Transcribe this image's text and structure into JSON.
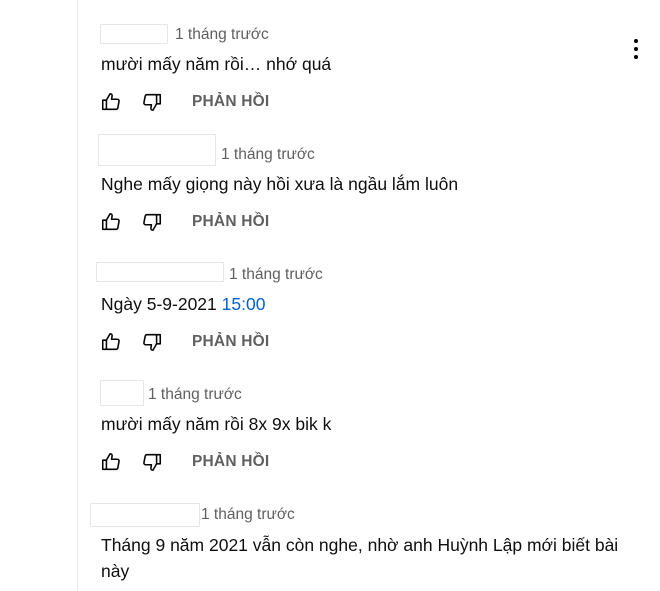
{
  "comments": [
    {
      "time": "1 tháng trước",
      "text": "mười mấy năm rồi… nhớ quá",
      "reply_label": "PHẢN HỒI"
    },
    {
      "time": "1 tháng trước",
      "text": "Nghe mấy giọng này hồi xưa là ngầu lắm luôn",
      "reply_label": "PHẢN HỒI"
    },
    {
      "time": "1 tháng trước",
      "text": "Ngày 5-9-2021 ",
      "timestamp_link": "15:00",
      "reply_label": "PHẢN HỒI"
    },
    {
      "time": "1 tháng trước",
      "text": "mười mấy năm rồi 8x 9x bik k",
      "reply_label": "PHẢN HỒI"
    },
    {
      "time": "1 tháng trước",
      "text": "Tháng 9 năm 2021 vẫn còn nghe, nhờ anh Huỳnh Lập mới biết bài này"
    }
  ],
  "icons": {
    "like": "thumbs-up-icon",
    "dislike": "thumbs-down-icon",
    "more": "more-vert-icon"
  },
  "colors": {
    "text": "#0f0f0f",
    "secondary": "#606060",
    "link": "#065fd4"
  }
}
